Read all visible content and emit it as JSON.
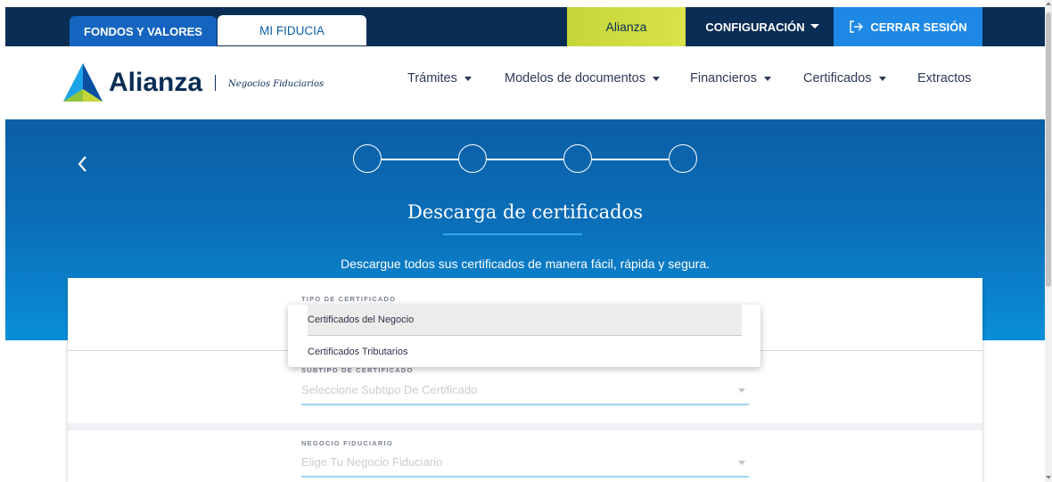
{
  "topbar": {
    "tabs": [
      {
        "label": "FONDOS Y VALORES"
      },
      {
        "label": "MI FIDUCIA"
      }
    ],
    "brand_label": "Alianza",
    "config_label": "CONFIGURACIÓN",
    "logout_label": "CERRAR SESIÓN",
    "colors": {
      "bar": "#0a2d55",
      "active_tab": "#1565c0",
      "brand_pill": "#c5d63a",
      "logout": "#1e88e5"
    }
  },
  "nav": {
    "logo_word": "Alianza",
    "logo_sub": "Negocios Fiduciarios",
    "items": [
      {
        "label": "Trámites",
        "has_menu": true
      },
      {
        "label": "Modelos de documentos",
        "has_menu": true
      },
      {
        "label": "Financieros",
        "has_menu": true
      },
      {
        "label": "Certificados",
        "has_menu": true
      },
      {
        "label": "Extractos",
        "has_menu": false
      }
    ]
  },
  "hero": {
    "back_icon": "chevron-left-icon",
    "steps": 4,
    "title": "Descarga de certificados",
    "subtitle": "Descargue todos sus certificados de manera fácil, rápida y segura."
  },
  "form": {
    "tipo": {
      "label": "TIPO DE CERTIFICADO"
    },
    "subtipo": {
      "label": "SUBTIPO DE CERTIFICADO",
      "placeholder": "Seleccione Subtipo De Certificado"
    },
    "negocio": {
      "label": "NEGOCIO FIDUCIARIO",
      "placeholder": "Elige Tu Negocio Fiduciario"
    }
  },
  "dropdown": {
    "options": [
      {
        "label": "Certificados del Negocio",
        "highlighted": true
      },
      {
        "label": "Certificados Tributarios",
        "highlighted": false
      }
    ]
  }
}
